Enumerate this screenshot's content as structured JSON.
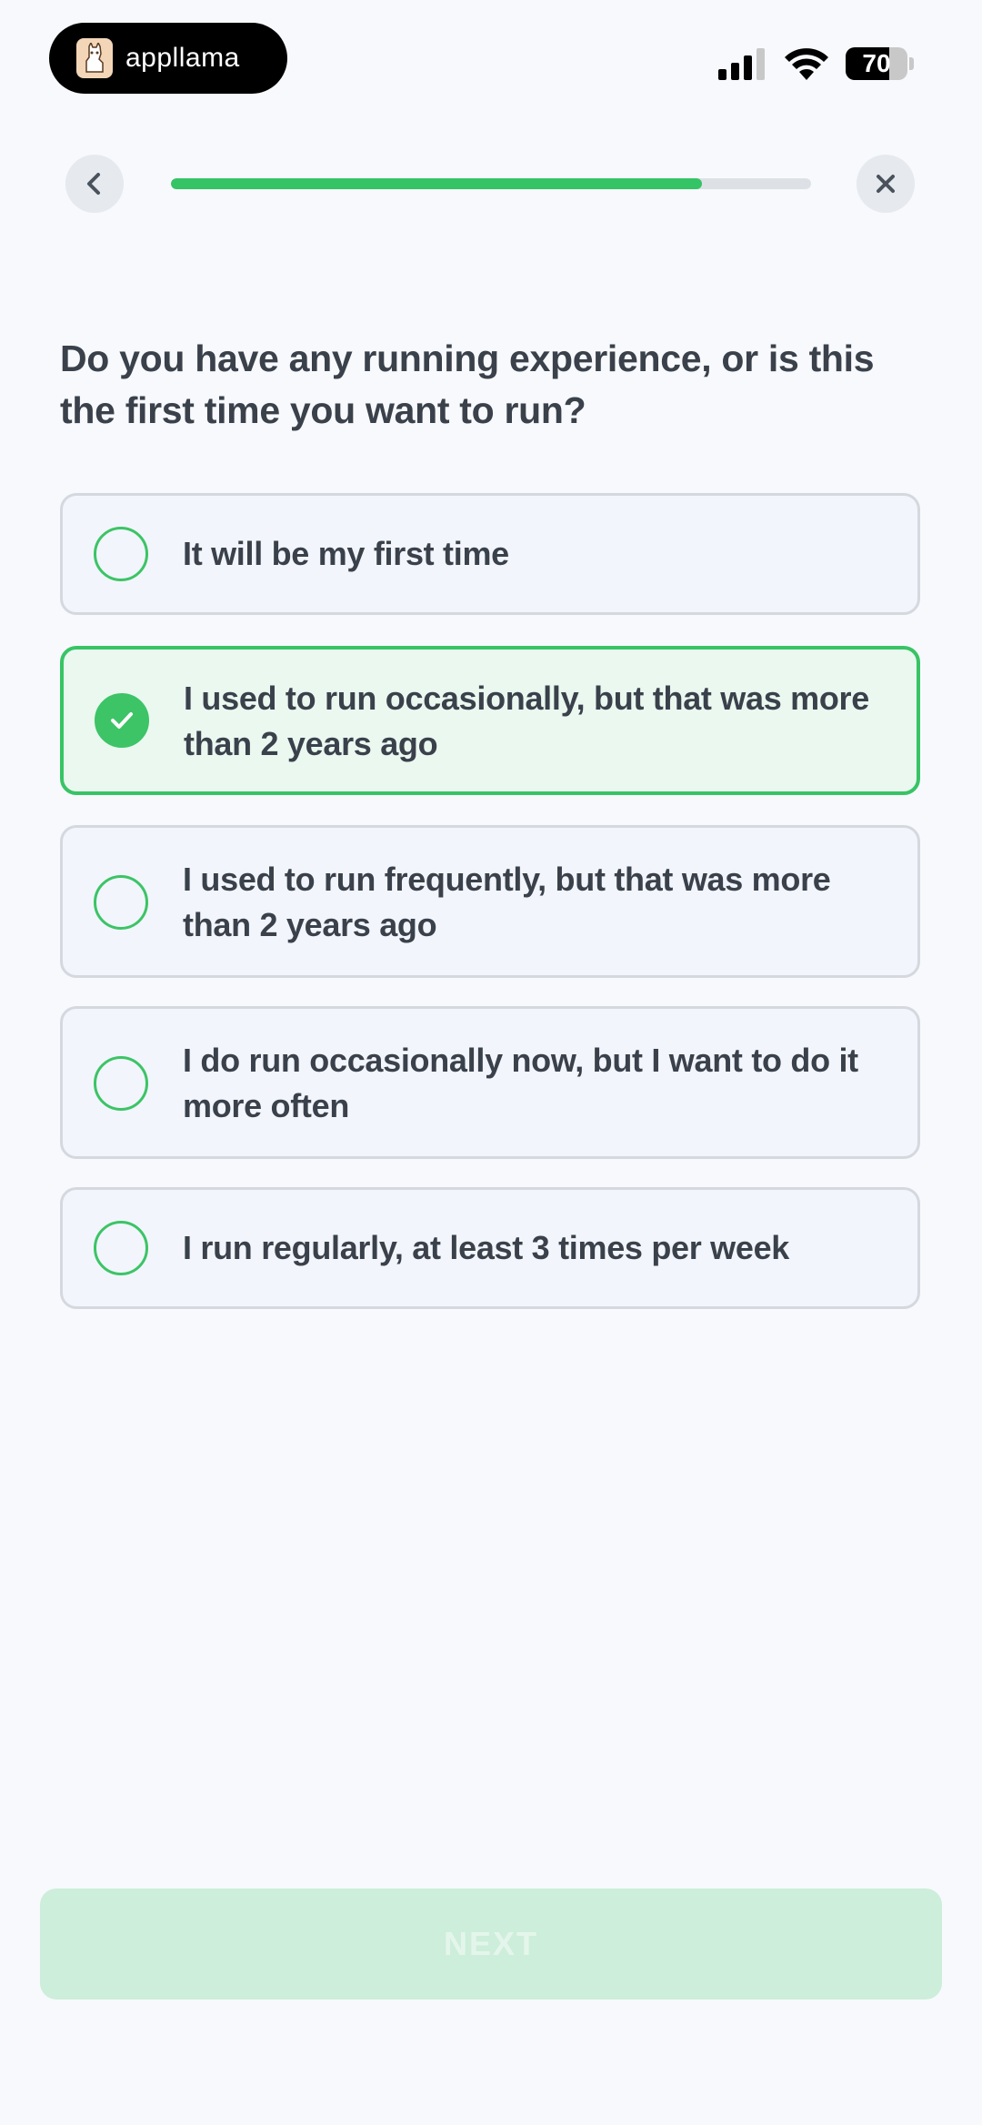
{
  "status_bar": {
    "app_name": "appllama",
    "battery_level": 70,
    "battery_text": "70",
    "icons": [
      "llama-logo-icon",
      "signal-icon",
      "wifi-icon",
      "battery-icon"
    ]
  },
  "nav": {
    "back_icon": "chevron-left-icon",
    "close_icon": "close-icon",
    "progress_fraction": 0.83
  },
  "question": "Do you have any running experience, or is this the first time you want to run?",
  "options": [
    {
      "label": "It will be my first time",
      "selected": false
    },
    {
      "label": "I used to run occasionally, but that was more than 2 years ago",
      "selected": true
    },
    {
      "label": "I used to run frequently, but that was more than 2 years ago",
      "selected": false
    },
    {
      "label": "I do run occasionally now, but I want to do it more often",
      "selected": false
    },
    {
      "label": "I run regularly, at least 3 times per week",
      "selected": false
    }
  ],
  "next_button": {
    "label": "NEXT"
  },
  "colors": {
    "accent": "#34c365",
    "background": "#f7f9fc",
    "selected_bg": "#eaf8f0"
  }
}
